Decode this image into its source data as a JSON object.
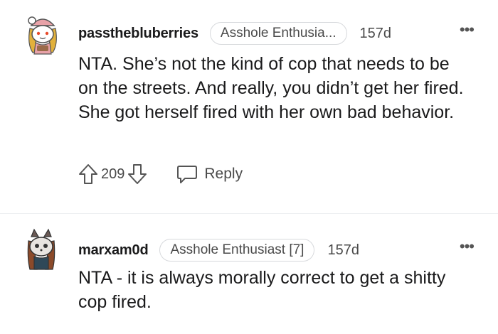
{
  "comments": [
    {
      "username": "passthebluberries",
      "flair": "Asshole Enthusia...",
      "timestamp": "157d",
      "more": "•••",
      "body": "NTA. She’s not the kind of cop that needs to be on the streets. And really, you didn’t get her fired. She got herself fired with her own bad behavior.",
      "score": "209",
      "reply_label": "Reply"
    },
    {
      "username": "marxam0d",
      "flair": "Asshole Enthusiast [7]",
      "timestamp": "157d",
      "more": "•••",
      "body": "NTA - it is always morally correct to get a shitty cop fired."
    }
  ],
  "icons": {
    "upvote": "arrow-up-icon",
    "downvote": "arrow-down-icon",
    "reply": "speech-bubble-icon",
    "more": "ellipsis-icon"
  },
  "colors": {
    "text": "#1a1a1b",
    "muted": "#4a4a4a",
    "divider": "#edeff1",
    "flair_border": "#d7d9dc"
  }
}
